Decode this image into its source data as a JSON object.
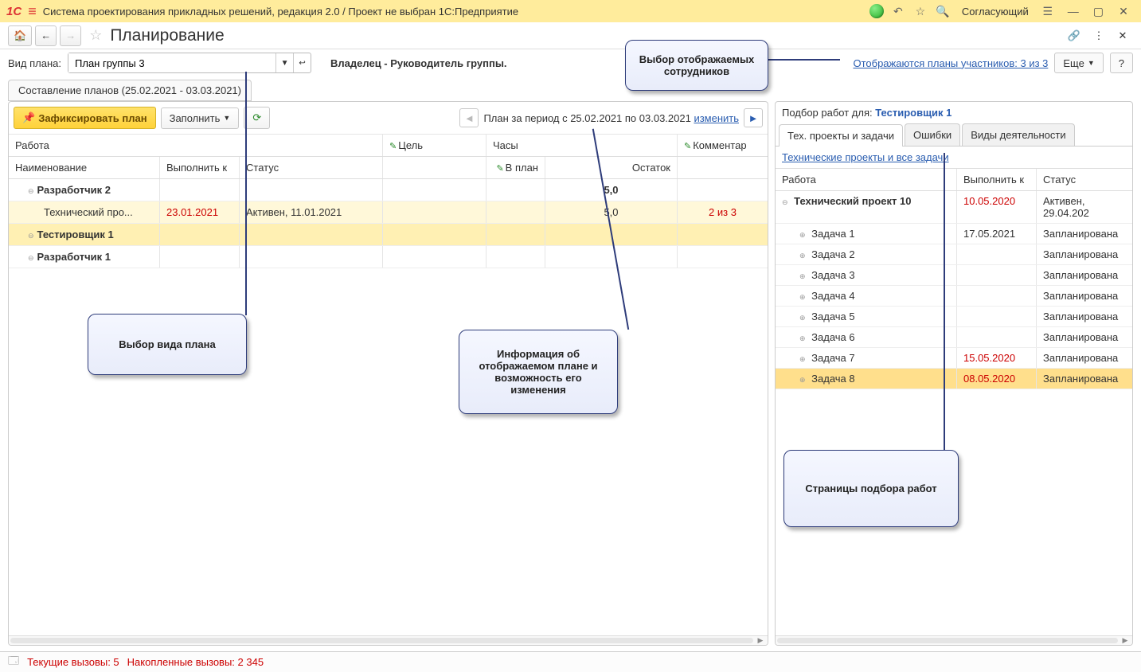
{
  "titlebar": {
    "title": "Система проектирования прикладных решений, редакция 2.0 / Проект не выбран 1С:Предприятие",
    "user_label": "Согласующий"
  },
  "topbar": {
    "page_title": "Планирование"
  },
  "controls": {
    "plan_type_label": "Вид плана:",
    "plan_type_value": "План группы 3",
    "owner_text": "Владелец - Руководитель  группы.",
    "shown_plans_link": "Отображаются планы участников: 3 из 3",
    "more_label": "Еще",
    "help_label": "?"
  },
  "section_tab": "Составление планов (25.02.2021 - 03.03.2021)",
  "left_toolbar": {
    "fix_label": "Зафиксировать план",
    "fill_label": "Заполнить",
    "period_prefix": "План за период с 25.02.2021 по 03.03.2021 ",
    "change_link": "изменить"
  },
  "left_table": {
    "hdr1": {
      "work": "Работа",
      "goal": "Цель",
      "hours": "Часы",
      "comment": "Комментар"
    },
    "hdr2": {
      "name": "Наименование",
      "due": "Выполнить к",
      "status": "Статус",
      "plan_hours": "В план",
      "rest": "Остаток"
    },
    "rows": [
      {
        "kind": "group",
        "name": "Разработчик 2",
        "hours_rest": "5,0"
      },
      {
        "kind": "item",
        "name": "Технический про...",
        "due": "23.01.2021",
        "due_red": true,
        "status": "Активен, 11.01.2021",
        "hours_rest": "5,0",
        "comment": "2 из 3",
        "comment_red": true
      },
      {
        "kind": "group_sel",
        "name": "Тестировщик 1"
      },
      {
        "kind": "group_plain",
        "name": "Разработчик 1"
      }
    ]
  },
  "right_panel": {
    "title_prefix": "Подбор работ для: ",
    "title_value": "Тестировщик 1",
    "tabs": [
      "Тех. проекты и задачи",
      "Ошибки",
      "Виды деятельности"
    ],
    "link": "Технические проекты и все задачи",
    "hdr": {
      "work": "Работа",
      "due": "Выполнить к",
      "status": "Статус"
    },
    "rows": [
      {
        "lvl": 0,
        "name": "Технический проект 10",
        "due": "10.05.2020",
        "due_red": true,
        "status": "Активен, 29.04.202",
        "bold": true,
        "root": true
      },
      {
        "lvl": 1,
        "name": "Задача 1",
        "due": "17.05.2021",
        "status": "Запланирована"
      },
      {
        "lvl": 1,
        "name": "Задача 2",
        "due": "",
        "status": "Запланирована"
      },
      {
        "lvl": 1,
        "name": "Задача 3",
        "due": "",
        "status": "Запланирована"
      },
      {
        "lvl": 1,
        "name": "Задача 4",
        "due": "",
        "status": "Запланирована"
      },
      {
        "lvl": 1,
        "name": "Задача 5",
        "due": "",
        "status": "Запланирована"
      },
      {
        "lvl": 1,
        "name": "Задача 6",
        "due": "",
        "status": "Запланирована"
      },
      {
        "lvl": 1,
        "name": "Задача 7",
        "due": "15.05.2020",
        "due_red": true,
        "status": "Запланирована"
      },
      {
        "lvl": 1,
        "name": "Задача 8",
        "due": "08.05.2020",
        "due_red": true,
        "status": "Запланирована",
        "selected": true
      }
    ]
  },
  "callouts": {
    "top_right": "Выбор отображаемых сотрудников",
    "plan_type": "Выбор вида плана",
    "period": "Информация об отображаемом плане и возможность его изменения",
    "right_tabs": "Страницы подбора работ"
  },
  "statusbar": {
    "current": "Текущие вызовы: 5",
    "accum": "Накопленные вызовы: 2 345"
  }
}
